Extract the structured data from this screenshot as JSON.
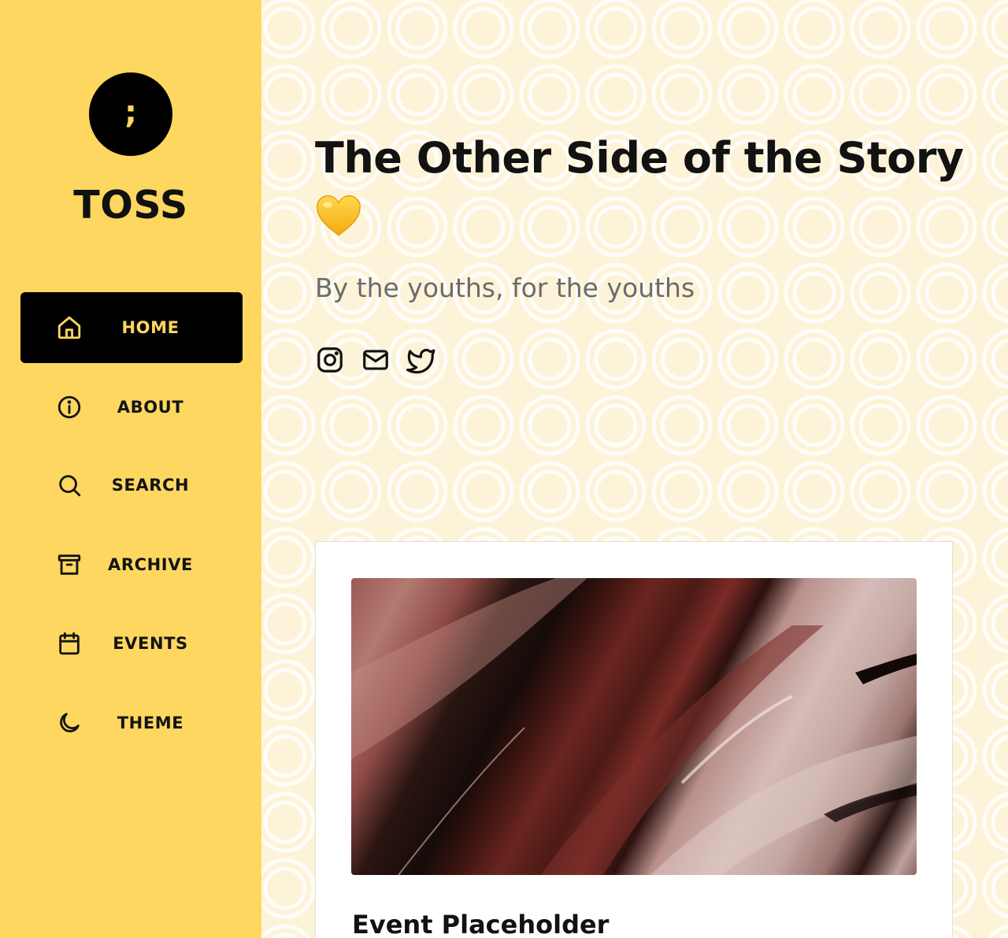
{
  "sidebar": {
    "logo_glyph": ";",
    "brand": "TOSS",
    "nav": [
      {
        "label": "HOME",
        "icon": "home-icon",
        "active": true
      },
      {
        "label": "ABOUT",
        "icon": "info-icon",
        "active": false
      },
      {
        "label": "SEARCH",
        "icon": "search-icon",
        "active": false
      },
      {
        "label": "ARCHIVE",
        "icon": "archive-icon",
        "active": false
      },
      {
        "label": "EVENTS",
        "icon": "calendar-icon",
        "active": false
      },
      {
        "label": "THEME",
        "icon": "moon-icon",
        "active": false
      }
    ]
  },
  "main": {
    "title": "The Other Side of the Story",
    "title_emoji": "yellow-heart-icon",
    "tagline": "By the youths, for the youths",
    "social": [
      "instagram-icon",
      "mail-icon",
      "twitter-icon"
    ],
    "card": {
      "title": "Event Placeholder"
    }
  },
  "colors": {
    "sidebar_bg": "#fed760",
    "active_bg": "#000000",
    "active_text": "#fed760",
    "main_bg": "#fdf3d8",
    "text": "#121212",
    "tagline": "#6b6b6b"
  }
}
